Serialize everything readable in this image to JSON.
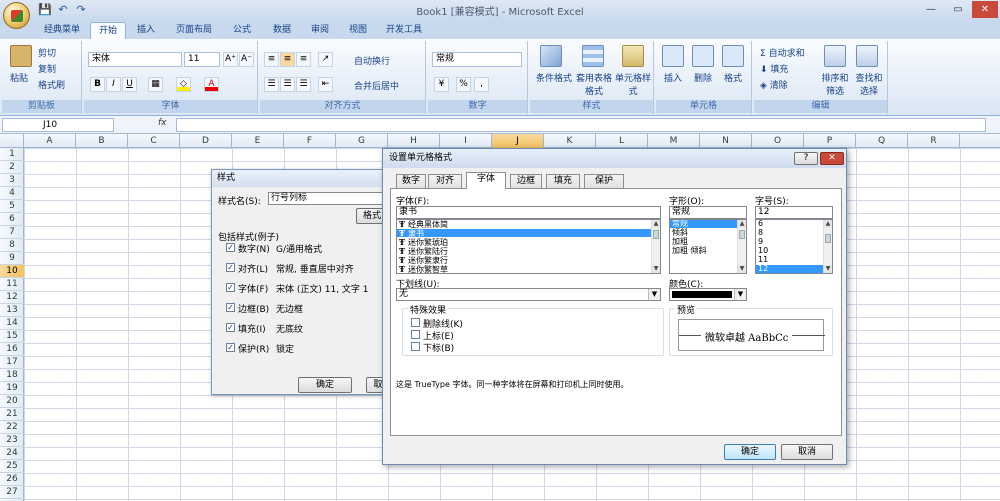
{
  "window": {
    "title": "Book1  [兼容模式] - Microsoft Excel",
    "minimize": "—",
    "restore": "▭",
    "close": "✕"
  },
  "qat": {
    "save": "💾",
    "undo": "↶",
    "redo": "↷"
  },
  "tabs": [
    "经典菜单",
    "开始",
    "插入",
    "页面布局",
    "公式",
    "数据",
    "审阅",
    "视图",
    "开发工具"
  ],
  "ribbon": {
    "clipboard": {
      "label": "剪贴板",
      "paste": "粘贴",
      "cut": "剪切",
      "copy": "复制",
      "format_painter": "格式刷"
    },
    "font": {
      "label": "字体",
      "font_name": "宋体",
      "font_size": "11",
      "grow": "A⁺",
      "shrink": "A⁻",
      "bold": "B",
      "italic": "I",
      "underline": "U"
    },
    "alignment": {
      "label": "对齐方式",
      "wrap": "自动换行",
      "merge": "合并后居中"
    },
    "number": {
      "label": "数字",
      "format": "常规",
      "currency": "¥",
      "percent": "%",
      "comma": ","
    },
    "styles": {
      "label": "样式",
      "conditional": "条件格式",
      "table": "套用表格格式",
      "cell_styles": "单元格样式"
    },
    "cells": {
      "label": "单元格",
      "insert": "插入",
      "delete": "删除",
      "format": "格式"
    },
    "editing": {
      "label": "编辑",
      "autosum": "自动求和",
      "fill": "填充",
      "clear": "清除",
      "sort": "排序和筛选",
      "find": "查找和选择"
    }
  },
  "formula_bar": {
    "name_box": "J10",
    "fx": "fx",
    "content": ""
  },
  "columns": [
    "A",
    "B",
    "C",
    "D",
    "E",
    "F",
    "G",
    "H",
    "I",
    "J",
    "K",
    "L",
    "M",
    "N",
    "O",
    "P",
    "Q",
    "R"
  ],
  "selected_column": "J",
  "rows": [
    "1",
    "2",
    "3",
    "4",
    "5",
    "6",
    "7",
    "8",
    "9",
    "10",
    "11",
    "12",
    "13",
    "14",
    "15",
    "16",
    "17",
    "18",
    "19",
    "20",
    "21",
    "22",
    "23",
    "24",
    "25",
    "26",
    "27"
  ],
  "selected_row": "10",
  "style_dialog": {
    "title": "样式",
    "style_name_label": "样式名(S):",
    "style_name_value": "行号列标",
    "format_button": "格式",
    "includes_label": "包括样式(例子)",
    "items": [
      {
        "label": "数字(N)",
        "value": "G/通用格式"
      },
      {
        "label": "对齐(L)",
        "value": "常规, 垂直居中对齐"
      },
      {
        "label": "字体(F)",
        "value": "宋体 (正文) 11, 文字 1"
      },
      {
        "label": "边框(B)",
        "value": "无边框"
      },
      {
        "label": "填充(I)",
        "value": "无底纹"
      },
      {
        "label": "保护(R)",
        "value": "锁定"
      }
    ],
    "ok": "确定",
    "cancel": "取"
  },
  "format_dialog": {
    "title": "设置单元格格式",
    "help": "?",
    "close": "✕",
    "tabs": [
      "数字",
      "对齐",
      "字体",
      "边框",
      "填充",
      "保护"
    ],
    "active_tab": "字体",
    "font_label": "字体(F):",
    "font_value": "隶书",
    "fonts": [
      "经典黑体简",
      "隶书",
      "迷你繁琥珀",
      "迷你繁陆行",
      "迷你繁隶行",
      "迷你繁智草"
    ],
    "font_selected": "隶书",
    "style_label": "字形(O):",
    "style_value": "常规",
    "styles": [
      "常规",
      "倾斜",
      "加粗",
      "加粗 倾斜"
    ],
    "style_selected": "常规",
    "size_label": "字号(S):",
    "size_value": "12",
    "sizes": [
      "6",
      "8",
      "9",
      "10",
      "11",
      "12"
    ],
    "size_selected": "12",
    "underline_label": "下划线(U):",
    "underline_value": "无",
    "color_label": "颜色(C):",
    "effects_label": "特殊效果",
    "effects": [
      "删除线(K)",
      "上标(E)",
      "下标(B)"
    ],
    "preview_label": "预览",
    "preview_text": "微软卓越  AaBbCc",
    "note": "这是 TrueType 字体。同一种字体将在屏幕和打印机上同时使用。",
    "ok": "确定",
    "cancel": "取消"
  }
}
